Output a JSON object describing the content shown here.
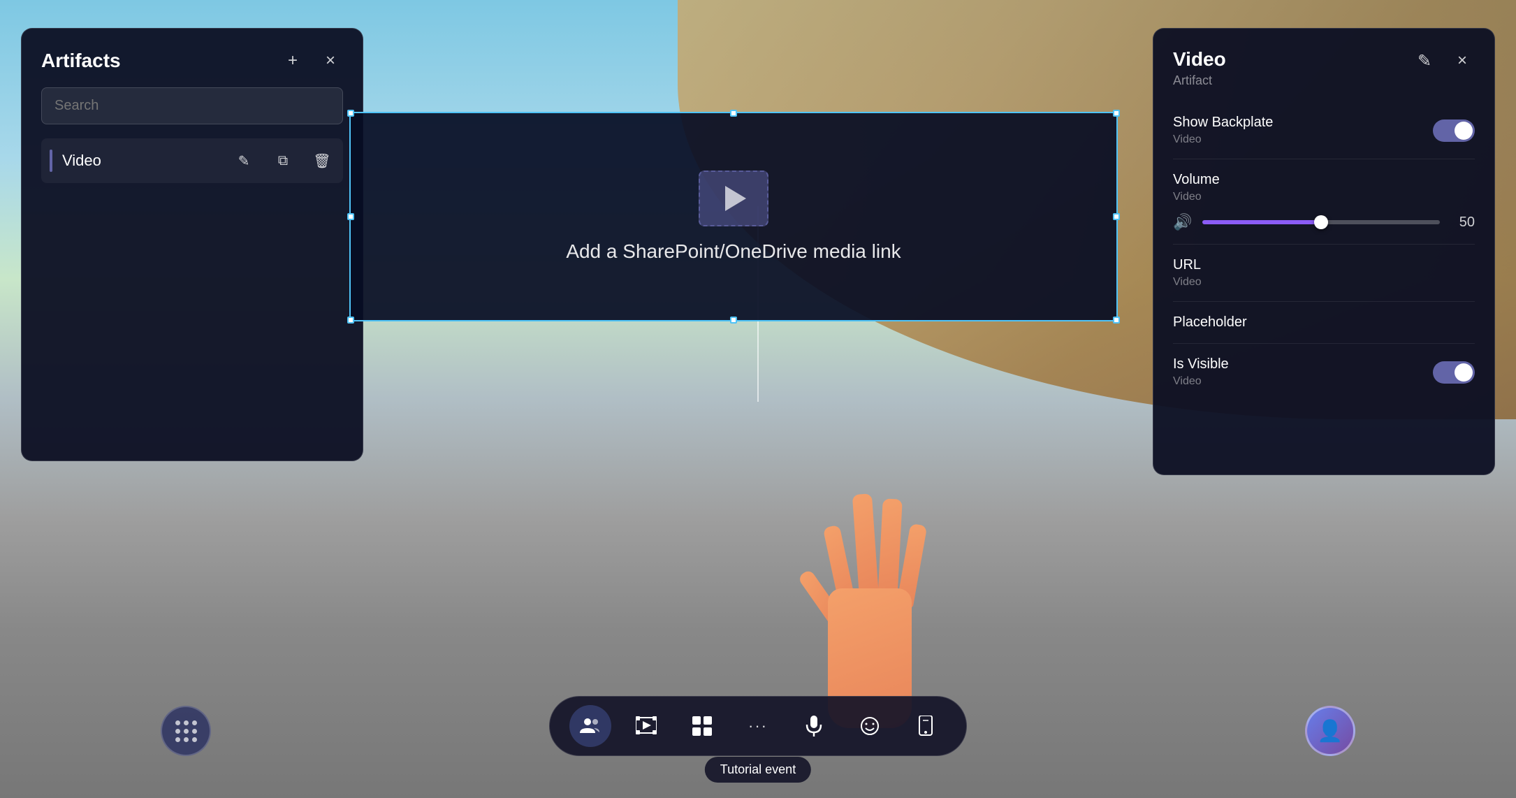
{
  "background": {
    "alt": "VR environment with wooden architecture and outdoor scene"
  },
  "left_panel": {
    "title": "Artifacts",
    "add_label": "+",
    "close_label": "×",
    "search_placeholder": "Search",
    "items": [
      {
        "name": "Video",
        "has_accent": true
      }
    ]
  },
  "right_panel": {
    "title": "Video",
    "subtitle": "Artifact",
    "edit_label": "✎",
    "close_label": "×",
    "properties": [
      {
        "key": "show_backplate",
        "label": "Show Backplate",
        "sublabel": "Video",
        "type": "toggle",
        "value": true
      },
      {
        "key": "volume",
        "label": "Volume",
        "sublabel": "Video",
        "type": "slider",
        "value": 50
      },
      {
        "key": "url",
        "label": "URL",
        "sublabel": "Video",
        "type": "text"
      },
      {
        "key": "placeholder",
        "label": "Placeholder",
        "sublabel": "",
        "type": "text"
      },
      {
        "key": "is_visible",
        "label": "Is Visible",
        "sublabel": "Video",
        "type": "toggle",
        "value": true
      }
    ]
  },
  "video_widget": {
    "prompt_text": "Add a SharePoint/OneDrive media link"
  },
  "toolbar": {
    "apps_tooltip": "Apps",
    "buttons": [
      {
        "key": "peoples",
        "icon": "👥",
        "label": "People",
        "active": true
      },
      {
        "key": "film",
        "icon": "🎬",
        "label": "Film",
        "active": false
      },
      {
        "key": "layout",
        "icon": "⊞",
        "label": "Layout",
        "active": false
      },
      {
        "key": "more",
        "icon": "•••",
        "label": "More",
        "active": false
      },
      {
        "key": "mic",
        "icon": "🎤",
        "label": "Microphone",
        "active": false
      },
      {
        "key": "emoji",
        "icon": "🙂",
        "label": "Emoji",
        "active": false
      },
      {
        "key": "share",
        "icon": "📱",
        "label": "Share",
        "active": false
      }
    ],
    "tooltip": "Tutorial event"
  },
  "icons": {
    "add": "+",
    "close": "×",
    "edit_pencil": "✎",
    "copy": "⧉",
    "delete": "🗑",
    "volume": "🔊"
  }
}
